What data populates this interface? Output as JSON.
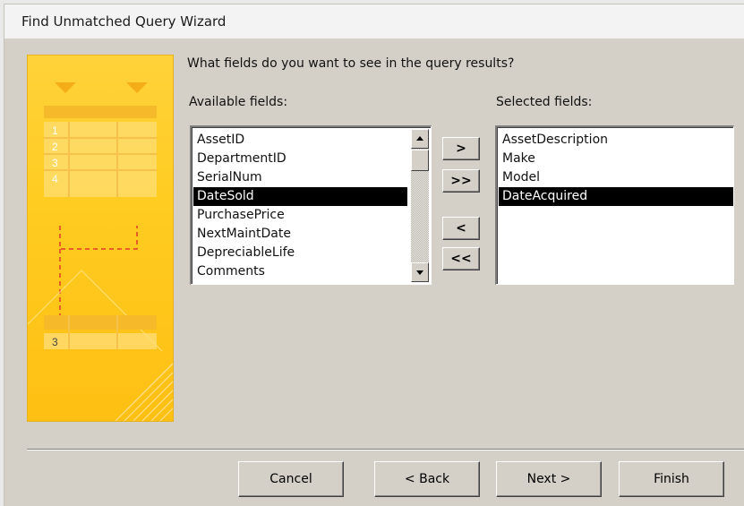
{
  "window": {
    "title": "Find Unmatched Query Wizard"
  },
  "graphic": {
    "row_numbers": [
      "1",
      "2",
      "3",
      "4"
    ],
    "result_number": "3"
  },
  "prompt": {
    "question": "What fields do you want to see in the query results?"
  },
  "available": {
    "label": "Available fields:",
    "items": [
      "AssetID",
      "DepartmentID",
      "SerialNum",
      "DateSold",
      "PurchasePrice",
      "NextMaintDate",
      "DepreciableLife",
      "Comments"
    ],
    "selected_item": "DateSold"
  },
  "selected": {
    "label": "Selected fields:",
    "items": [
      "AssetDescription",
      "Make",
      "Model",
      "DateAcquired"
    ],
    "selected_item": "DateAcquired"
  },
  "move_buttons": {
    "add_one": ">",
    "add_all": ">>",
    "remove_one": "<",
    "remove_all": "<<"
  },
  "buttons": {
    "cancel": "Cancel",
    "back": "< Back",
    "next": "Next >",
    "finish": "Finish"
  }
}
